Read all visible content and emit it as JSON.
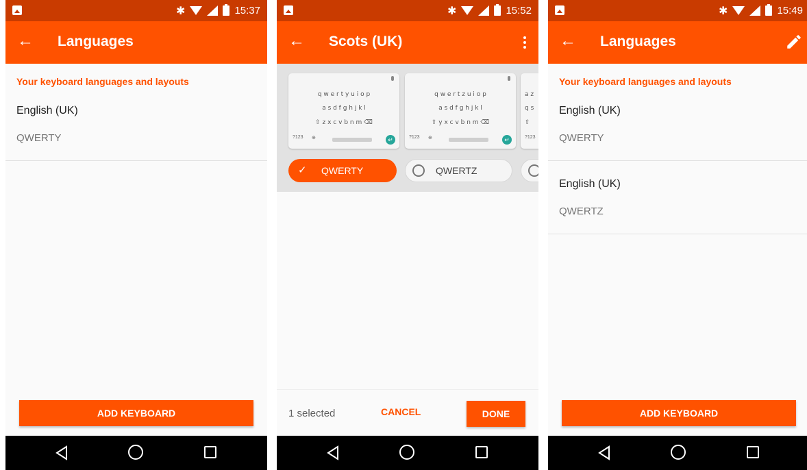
{
  "colors": {
    "accent": "#ff5200",
    "status_bar": "#c93b00",
    "nav_bar": "#000000"
  },
  "status_icons": [
    "image-icon",
    "bluetooth-icon",
    "wifi-icon",
    "signal-icon",
    "battery-icon"
  ],
  "screen1": {
    "time": "15:37",
    "title": "Languages",
    "section_header": "Your keyboard languages and layouts",
    "items": [
      {
        "name": "English (UK)",
        "layout": "QWERTY"
      }
    ],
    "add_button": "ADD KEYBOARD"
  },
  "screen2": {
    "time": "15:52",
    "title": "Scots (UK)",
    "keyboard_previews": [
      {
        "row1": "q w e r t y u i o p",
        "row2": "a s d f g h j k l",
        "row3": "⇧ z x c v b n m ⌫"
      },
      {
        "row1": "q w e r t z u i o p",
        "row2": "a s d f g h j k l",
        "row3": "⇧ y x c v b n m ⌫"
      },
      {
        "row1": "a z",
        "row2": "q s",
        "row3": "⇧"
      }
    ],
    "kb_sym": "?123",
    "layouts": [
      {
        "label": "QWERTY",
        "selected": true
      },
      {
        "label": "QWERTZ",
        "selected": false
      }
    ],
    "selected_count": "1 selected",
    "cancel": "CANCEL",
    "done": "DONE"
  },
  "screen3": {
    "time": "15:49",
    "title": "Languages",
    "section_header": "Your keyboard languages and layouts",
    "items": [
      {
        "name": "English (UK)",
        "layout": "QWERTY"
      },
      {
        "name": "English (UK)",
        "layout": "QWERTZ"
      }
    ],
    "add_button": "ADD KEYBOARD"
  }
}
